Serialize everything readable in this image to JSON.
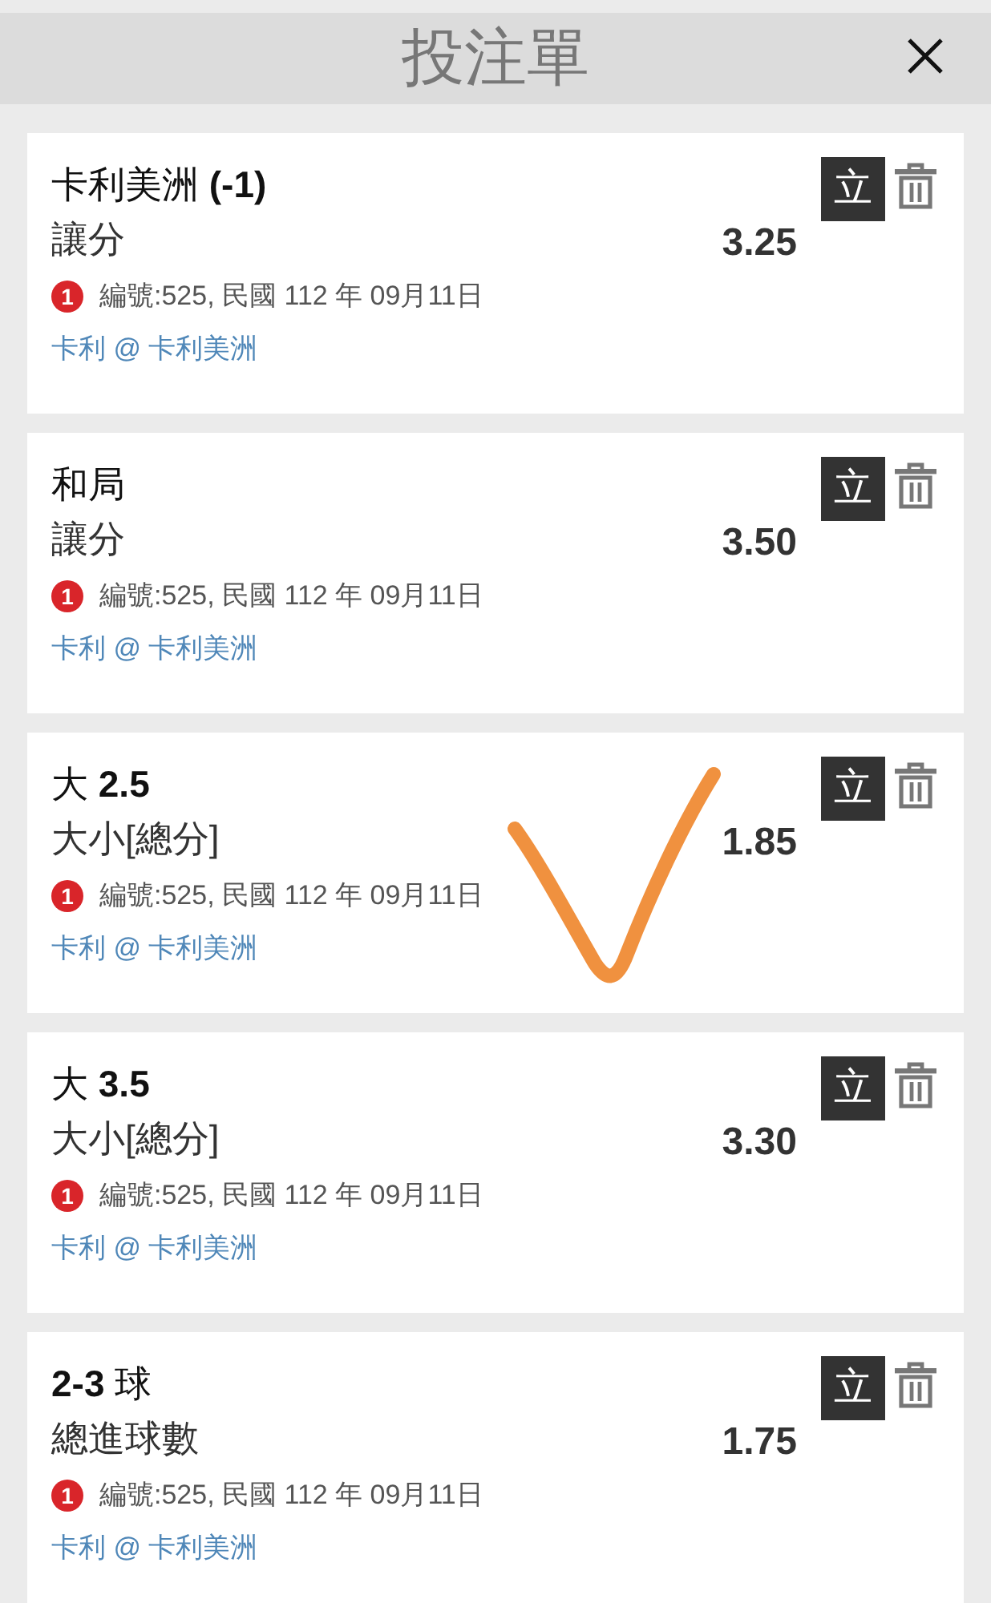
{
  "header": {
    "title": "投注單"
  },
  "bets": [
    {
      "selection": "卡利美洲 **(-1)**",
      "market": "讓分",
      "odds": "3.25",
      "badge": "1",
      "info": "編號:525, 民國 112 年 09月11日",
      "match": "卡利 @ 卡利美洲",
      "action": "立",
      "ticked": false
    },
    {
      "selection": "和局",
      "market": "讓分",
      "odds": "3.50",
      "badge": "1",
      "info": "編號:525, 民國 112 年 09月11日",
      "match": "卡利 @ 卡利美洲",
      "action": "立",
      "ticked": false
    },
    {
      "selection": "大 **2.5**",
      "market": "大小[總分]",
      "odds": "1.85",
      "badge": "1",
      "info": "編號:525, 民國 112 年 09月11日",
      "match": "卡利 @ 卡利美洲",
      "action": "立",
      "ticked": true
    },
    {
      "selection": "大 **3.5**",
      "market": "大小[總分]",
      "odds": "3.30",
      "badge": "1",
      "info": "編號:525, 民國 112 年 09月11日",
      "match": "卡利 @ 卡利美洲",
      "action": "立",
      "ticked": false
    },
    {
      "selection": "**2-3** 球",
      "market": "總進球數",
      "odds": "1.75",
      "badge": "1",
      "info": "編號:525, 民國 112 年 09月11日",
      "match": "卡利 @ 卡利美洲",
      "action": "立",
      "ticked": false
    }
  ]
}
